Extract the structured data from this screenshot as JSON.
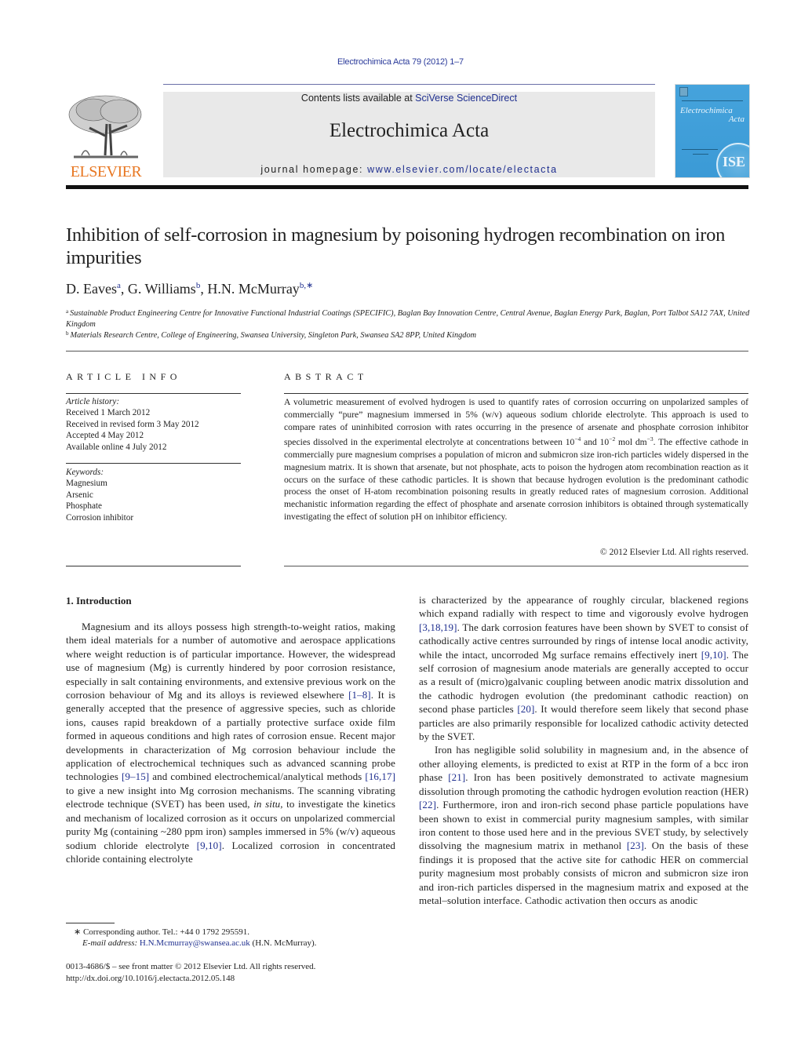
{
  "header": {
    "journal_ref": "Electrochimica Acta 79 (2012) 1–7",
    "publisher_logo_text": "ELSEVIER",
    "contents_prefix": "Contents lists available at ",
    "contents_link": "SciVerse ScienceDirect",
    "journal_title": "Electrochimica Acta",
    "homepage_prefix": "journal homepage: ",
    "homepage_link": "www.elsevier.com/locate/electacta",
    "cover": {
      "title_line1": "Electrochimica",
      "title_line2": "Acta",
      "seal_text": "ISE"
    },
    "colors": {
      "link": "#1f2f8f",
      "elsevier_orange": "#e87722",
      "masthead_bg": "#e9e9e9",
      "cover_blue": "#45a3dc"
    }
  },
  "article": {
    "title": "Inhibition of self-corrosion in magnesium by poisoning hydrogen recombination on iron impurities",
    "authors": [
      {
        "name": "D. Eaves",
        "sup": "a"
      },
      {
        "name": "G. Williams",
        "sup": "b"
      },
      {
        "name": "H.N. McMurray",
        "sup": "b,∗"
      }
    ],
    "affiliations": [
      {
        "mark": "a",
        "text": "Sustainable Product Engineering Centre for Innovative Functional Industrial Coatings (SPECIFIC), Baglan Bay Innovation Centre, Central Avenue, Baglan Energy Park, Baglan, Port Talbot SA12 7AX, United Kingdom"
      },
      {
        "mark": "b",
        "text": "Materials Research Centre, College of Engineering, Swansea University, Singleton Park, Swansea SA2 8PP, United Kingdom"
      }
    ]
  },
  "article_info": {
    "heading": "ARTICLE INFO",
    "history_label": "Article history:",
    "history": [
      "Received 1 March 2012",
      "Received in revised form 3 May 2012",
      "Accepted 4 May 2012",
      "Available online 4 July 2012"
    ],
    "keywords_label": "Keywords:",
    "keywords": [
      "Magnesium",
      "Arsenic",
      "Phosphate",
      "Corrosion inhibitor"
    ]
  },
  "abstract": {
    "heading": "ABSTRACT",
    "part1": "A volumetric measurement of evolved hydrogen is used to quantify rates of corrosion occurring on unpolarized samples of commercially “pure” magnesium immersed in 5% (w/v) aqueous sodium chloride electrolyte. This approach is used to compare rates of uninhibited corrosion with rates occurring in the presence of arsenate and phosphate corrosion inhibitor species dissolved in the experimental electrolyte at concentrations between 10",
    "exp1": "−4",
    "part2": " and 10",
    "exp2": "−2",
    "part3": " mol dm",
    "exp3": "−3",
    "part4": ". The effective cathode in commercially pure magnesium comprises a population of micron and submicron size iron-rich particles widely dispersed in the magnesium matrix. It is shown that arsenate, but not phosphate, acts to poison the hydrogen atom recombination reaction as it occurs on the surface of these cathodic particles. It is shown that because hydrogen evolution is the predominant cathodic process the onset of H-atom recombination poisoning results in greatly reduced rates of magnesium corrosion. Additional mechanistic information regarding the effect of phosphate and arsenate corrosion inhibitors is obtained through systematically investigating the effect of solution pH on inhibitor efficiency.",
    "copyright": "© 2012 Elsevier Ltd. All rights reserved."
  },
  "introduction": {
    "heading": "1.  Introduction",
    "left": {
      "s1": "Magnesium and its alloys possess high strength-to-weight ratios, making them ideal materials for a number of automotive and aerospace applications where weight reduction is of particular importance. However, the widespread use of magnesium (Mg) is currently hindered by poor corrosion resistance, especially in salt containing environments, and extensive previous work on the corrosion behaviour of Mg and its alloys is reviewed elsewhere ",
      "r1": "[1–8]",
      "s2": ". It is generally accepted that the presence of aggressive species, such as chloride ions, causes rapid breakdown of a partially protective surface oxide film formed in aqueous conditions and high rates of corrosion ensue. Recent major developments in characterization of Mg corrosion behaviour include the application of electrochemical techniques such as advanced scanning probe technologies ",
      "r2": "[9–15]",
      "s3": " and combined electrochemical/analytical methods ",
      "r3": "[16,17]",
      "s4": " to give a new insight into Mg corrosion mechanisms. The scanning vibrating electrode technique (SVET) has been used, ",
      "it1": "in situ",
      "s5": ", to investigate the kinetics and mechanism of localized corrosion as it occurs on unpolarized commercial purity Mg (containing ~280 ppm iron) samples immersed in 5% (w/v) aqueous sodium chloride electrolyte ",
      "r4": "[9,10]",
      "s6": ". Localized corrosion in concentrated chloride containing electrolyte"
    },
    "right_p1": {
      "s1": "is characterized by the appearance of roughly circular, blackened regions which expand radially with respect to time and vigorously evolve hydrogen ",
      "r1": "[3,18,19]",
      "s2": ". The dark corrosion features have been shown by SVET to consist of cathodically active centres surrounded by rings of intense local anodic activity, while the intact, uncorroded Mg surface remains effectively inert ",
      "r2": "[9,10]",
      "s3": ". The self corrosion of magnesium anode materials are generally accepted to occur as a result of (micro)galvanic coupling between anodic matrix dissolution and the cathodic hydrogen evolution (the predominant cathodic reaction) on second phase particles ",
      "r3": "[20]",
      "s4": ". It would therefore seem likely that second phase particles are also primarily responsible for localized cathodic activity detected by the SVET."
    },
    "right_p2": {
      "s1": "Iron has negligible solid solubility in magnesium and, in the absence of other alloying elements, is predicted to exist at RTP in the form of a bcc iron phase ",
      "r1": "[21]",
      "s2": ". Iron has been positively demonstrated to activate magnesium dissolution through promoting the cathodic hydrogen evolution reaction (HER) ",
      "r2": "[22]",
      "s3": ". Furthermore, iron and iron-rich second phase particle populations have been shown to exist in commercial purity magnesium samples, with similar iron content to those used here and in the previous SVET study, by selectively dissolving the magnesium matrix in methanol ",
      "r3": "[23]",
      "s4": ". On the basis of these findings it is proposed that the active site for cathodic HER on commercial purity magnesium most probably consists of micron and submicron size iron and iron-rich particles dispersed in the magnesium matrix and exposed at the metal–solution interface. Cathodic activation then occurs as anodic"
    }
  },
  "footnotes": {
    "corresponding": "∗  Corresponding author. Tel.: +44 0 1792 295591.",
    "email_label": "E-mail address: ",
    "email": "H.N.Mcmurray@swansea.ac.uk",
    "email_suffix": " (H.N. McMurray).",
    "front_matter": "0013-4686/$ – see front matter © 2012 Elsevier Ltd. All rights reserved.",
    "doi": "http://dx.doi.org/10.1016/j.electacta.2012.05.148"
  }
}
